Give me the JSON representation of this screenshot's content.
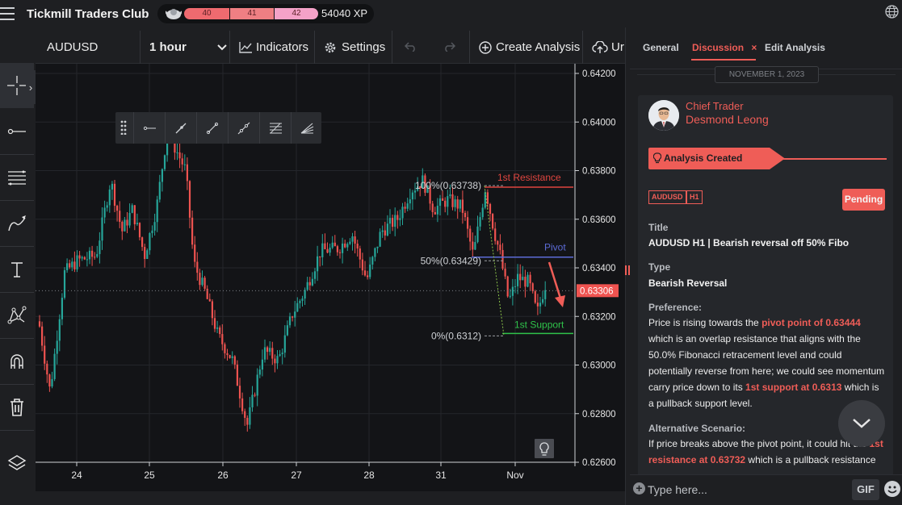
{
  "app": {
    "title": "Tickmill Traders Club",
    "xp_levels": [
      "40",
      "41",
      "42"
    ],
    "xp": "54040 XP"
  },
  "chart_toolbar": {
    "symbol": "AUDUSD",
    "interval": "1 hour",
    "indicators": "Indicators",
    "settings": "Settings",
    "create_analysis": "Create Analysis",
    "upload": "Ur"
  },
  "chart": {
    "y_ticks": [
      "0.64200",
      "0.64000",
      "0.63800",
      "0.63600",
      "0.63400",
      "0.63200",
      "0.63000",
      "0.62800",
      "0.62600"
    ],
    "x_ticks": [
      "24",
      "25",
      "26",
      "27",
      "28",
      "31",
      "Nov"
    ],
    "current_price": "0.63306",
    "labels": {
      "resistance": "1st Resistance",
      "pivot": "Pivot",
      "support": "1st Support",
      "fib100": "100%(0.63738)",
      "fib50": "50%(0.63429)",
      "fib0": "0%(0.6312)"
    },
    "colors": {
      "up": "#26a69a",
      "down": "#ef5350",
      "resistance": "#e0453f",
      "pivot": "#5c6bd6",
      "support": "#2fc24a",
      "accent": "#ef5d57"
    }
  },
  "chart_data": {
    "type": "candlestick",
    "symbol": "AUDUSD",
    "interval": "1 hour",
    "x_ticks": [
      "24",
      "25",
      "26",
      "27",
      "28",
      "31",
      "Nov"
    ],
    "ylim": [
      0.626,
      0.642
    ],
    "levels": {
      "resistance": 0.63732,
      "pivot": 0.63444,
      "support": 0.6313,
      "current": 0.63306
    },
    "fibonacci": {
      "100%": 0.63738,
      "50%": 0.63429,
      "0%": 0.6312
    }
  },
  "panel": {
    "tabs": [
      "General",
      "Discussion",
      "Edit Analysis"
    ],
    "close_glyph": "×",
    "date": "NOVEMBER 1, 2023",
    "author_role": "Chief Trader",
    "author_name": "Desmond Leong",
    "banner": "Analysis Created",
    "tags": [
      "AUDUSD",
      "H1"
    ],
    "status": "Pending",
    "title_label": "Title",
    "title_value": "AUDUSD H1 | Bearish reversal off 50% Fibo",
    "type_label": "Type",
    "type_value": "Bearish Reversal",
    "preference_label": "Preference:",
    "pref_1": "Price is rising towards the ",
    "pref_hl1": "pivot point of 0.63444",
    "pref_2": " which is an overlap resistance that aligns with the 50.0% Fibonacci retracement level and could potentially reverse from here; we could see momentum carry price down to its ",
    "pref_hl2": "1st support at 0.6313",
    "pref_3": " which is a pullback support level.",
    "alt_label": "Alternative Scenario:",
    "alt_1": "If price breaks above the pivot point, it could hit the ",
    "alt_hl1": "1st resistance at 0.63732",
    "alt_2": " which is a pullback resistance",
    "input_placeholder": "Type here...",
    "gif": "GIF"
  }
}
